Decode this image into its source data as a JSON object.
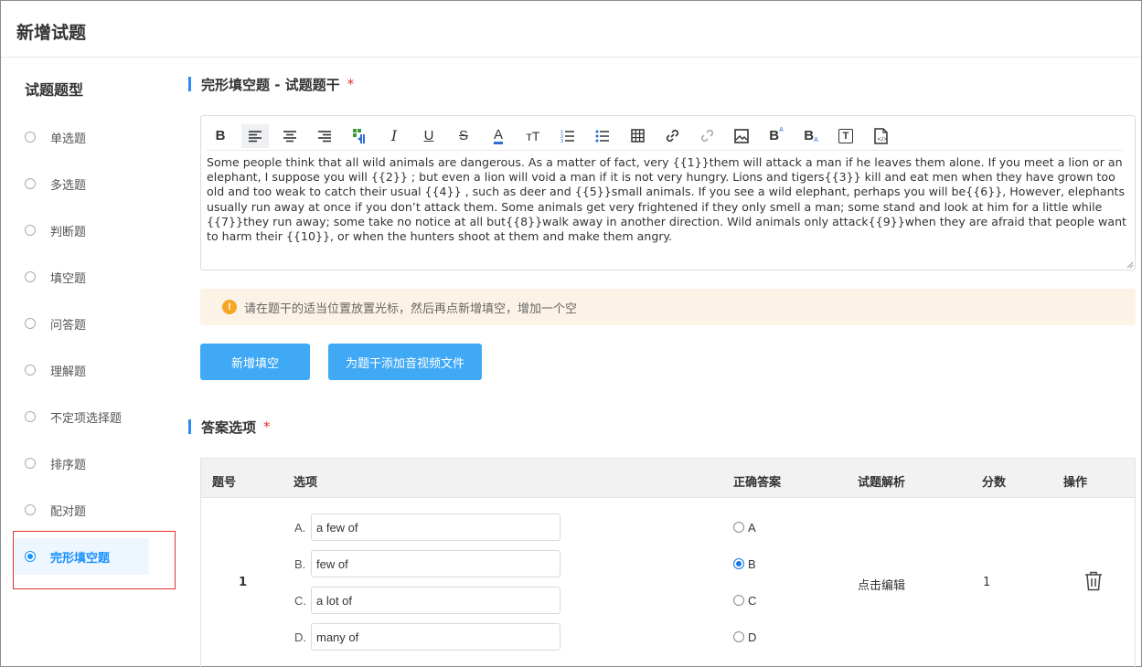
{
  "page": {
    "title": "新增试题"
  },
  "sidebar": {
    "title": "试题题型",
    "items": [
      {
        "label": "单选题",
        "active": false
      },
      {
        "label": "多选题",
        "active": false
      },
      {
        "label": "判断题",
        "active": false
      },
      {
        "label": "填空题",
        "active": false
      },
      {
        "label": "问答题",
        "active": false
      },
      {
        "label": "理解题",
        "active": false
      },
      {
        "label": "不定项选择题",
        "active": false
      },
      {
        "label": "排序题",
        "active": false
      },
      {
        "label": "配对题",
        "active": false
      },
      {
        "label": "完形填空题",
        "active": true
      }
    ]
  },
  "stem": {
    "title": "完形填空题 - 试题题干",
    "required_mark": "*",
    "toolbar": [
      {
        "icon": "bold-icon",
        "glyph": "B"
      },
      {
        "icon": "align-left-icon"
      },
      {
        "icon": "align-center-icon"
      },
      {
        "icon": "align-right-icon"
      },
      {
        "icon": "text-direction-icon"
      },
      {
        "icon": "italic-icon",
        "glyph": "I"
      },
      {
        "icon": "underline-icon",
        "glyph": "U"
      },
      {
        "icon": "strikethrough-icon",
        "glyph": "S"
      },
      {
        "icon": "font-color-icon",
        "glyph": "A"
      },
      {
        "icon": "font-size-icon",
        "glyph": "тT"
      },
      {
        "icon": "ordered-list-icon"
      },
      {
        "icon": "unordered-list-icon"
      },
      {
        "icon": "table-icon"
      },
      {
        "icon": "link-icon"
      },
      {
        "icon": "unlink-icon"
      },
      {
        "icon": "image-icon"
      },
      {
        "icon": "superscript-icon",
        "glyph": "B"
      },
      {
        "icon": "subscript-icon",
        "glyph": "B"
      },
      {
        "icon": "text-box-icon",
        "glyph": "T"
      },
      {
        "icon": "source-code-icon"
      }
    ],
    "text": "Some people think that all wild animals are dangerous. As a matter of fact, very {{1}}them will attack a man if he leaves them alone. If you meet a lion or an elephant, I suppose you will {{2}} ; but even a lion will void a man if it is not very hungry. Lions and tigers{{3}} kill and eat men when they have grown too old and too weak to catch their usual {{4}} , such as deer and {{5}}small animals. If you see a wild elephant, perhaps you will be{{6}}, However, elephants usually run away at once if you don’t attack them. Some animals get very frightened if they only smell a man; some stand and look at him for a little while {{7}}they run away; some take no notice at all but{{8}}walk away in another direction. Wild animals only attack{{9}}when they are afraid that people want to harm their {{10}}, or when the hunters shoot at them and make them angry."
  },
  "notice": {
    "icon": "warning-icon",
    "icon_glyph": "!",
    "text": "请在题干的适当位置放置光标，然后再点新增填空，增加一个空"
  },
  "buttons": {
    "add_blank": "新增填空",
    "add_media": "为题干添加音视频文件"
  },
  "answers": {
    "title": "答案选项",
    "required_mark": "*",
    "columns": [
      "题号",
      "选项",
      "正确答案",
      "试题解析",
      "分数",
      "操作"
    ],
    "rows": [
      {
        "number": "1",
        "options": [
          {
            "letter": "A.",
            "value": "a few of"
          },
          {
            "letter": "B.",
            "value": "few of"
          },
          {
            "letter": "C.",
            "value": "a lot of"
          },
          {
            "letter": "D.",
            "value": "many of"
          }
        ],
        "choices": [
          {
            "label": "A",
            "checked": false
          },
          {
            "label": "B",
            "checked": true
          },
          {
            "label": "C",
            "checked": false
          },
          {
            "label": "D",
            "checked": false
          }
        ],
        "analysis": "点击编辑",
        "score": "1",
        "action_icon": "trash-icon"
      }
    ]
  },
  "colors": {
    "accent": "#2d8cf0",
    "button": "#40a9f5",
    "required": "#e0322c",
    "notice_bg": "#fdf2e6",
    "warning": "#f5a623"
  }
}
